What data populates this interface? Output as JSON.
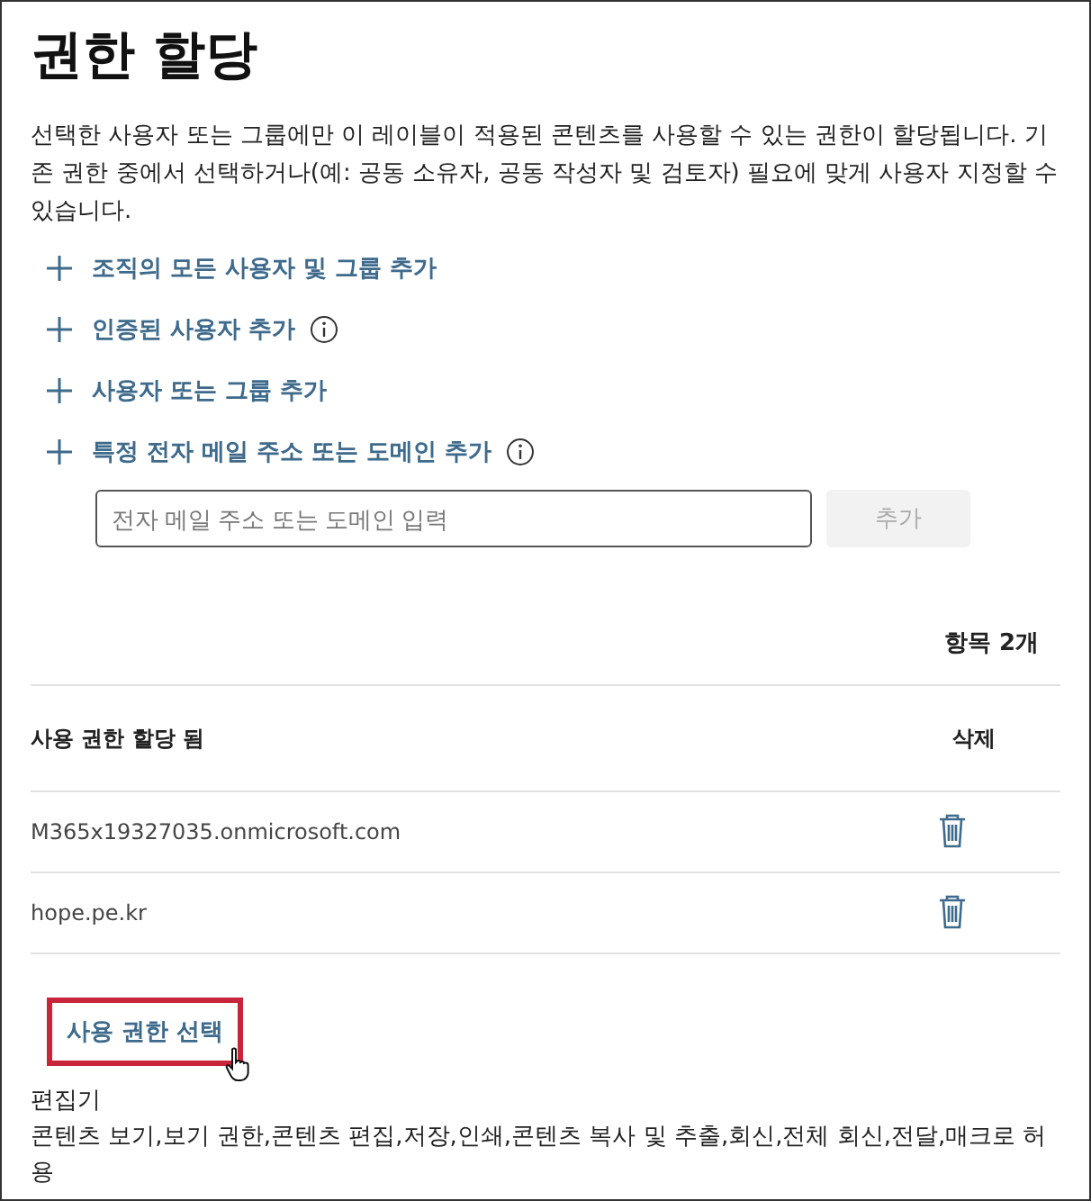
{
  "title": "권한 할당",
  "description": "선택한 사용자 또는 그룹에만 이 레이블이 적용된 콘텐츠를 사용할 수 있는 권한이 할당됩니다. 기존 권한 중에서 선택하거나(예: 공동 소유자, 공동 작성자 및 검토자) 필요에 맞게 사용자 지정할 수 있습니다.",
  "actions": [
    {
      "label": "조직의 모든 사용자 및 그룹 추가",
      "info": false
    },
    {
      "label": "인증된 사용자 추가",
      "info": true
    },
    {
      "label": "사용자 또는 그룹 추가",
      "info": false
    },
    {
      "label": "특정 전자 메일 주소 또는 도메인 추가",
      "info": true
    }
  ],
  "email_field": {
    "placeholder": "전자 메일 주소 또는 도메인 입력"
  },
  "add_button": {
    "label": "추가",
    "disabled": true
  },
  "item_count": "항목 2개",
  "table": {
    "columns": [
      "사용 권한 할당 됨",
      "삭제"
    ],
    "rows": [
      {
        "name": "M365x19327035.onmicrosoft.com"
      },
      {
        "name": "hope.pe.kr"
      }
    ]
  },
  "choose_link": {
    "label": "사용 권한 선택",
    "highlighted": true
  },
  "permission": {
    "role": "편집기",
    "rights": "콘텐츠 보기,보기 권한,콘텐츠 편집,저장,인쇄,콘텐츠 복사 및 추출,회신,전체 회신,전달,매크로 허용"
  }
}
